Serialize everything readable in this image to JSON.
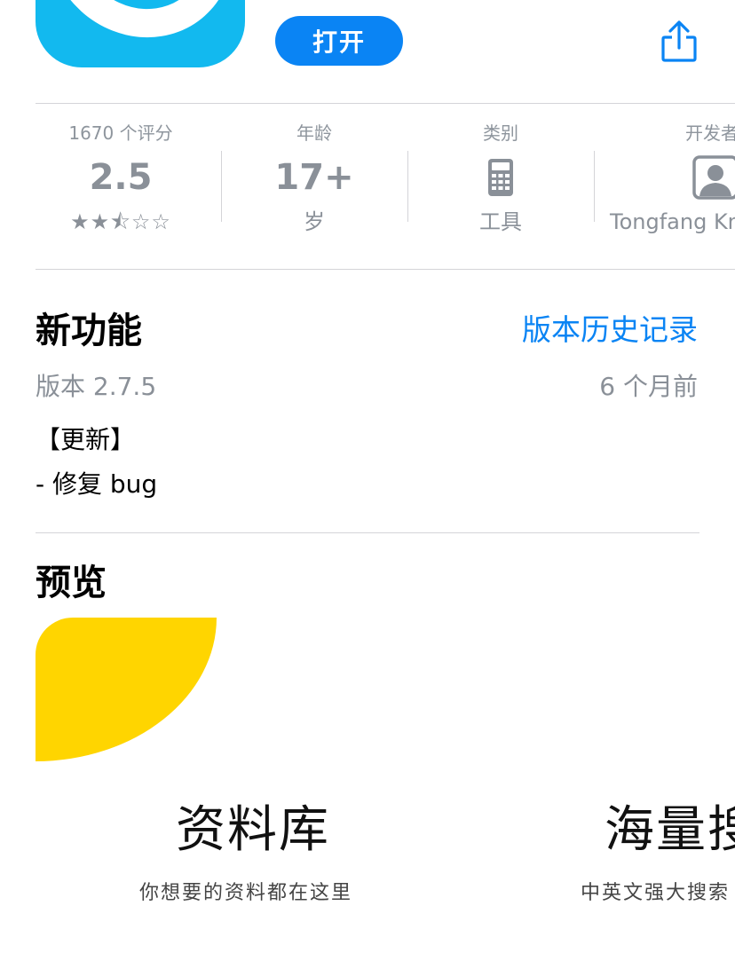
{
  "header": {
    "open_label": "打开"
  },
  "info": {
    "ratings": {
      "head": "1670 个评分",
      "value": "2.5",
      "stars": "★★⯪☆☆"
    },
    "age": {
      "head": "年龄",
      "value": "17+",
      "unit": "岁"
    },
    "category": {
      "head": "类别",
      "value": "工具"
    },
    "developer": {
      "head": "开发者",
      "value": "Tongfang Kn"
    }
  },
  "whats_new": {
    "title": "新功能",
    "history_link": "版本历史记录",
    "version": "版本 2.7.5",
    "time_ago": "6 个月前",
    "notes": [
      "【更新】",
      "- 修复 bug"
    ]
  },
  "preview": {
    "title": "预览",
    "shots": [
      {
        "title": "资料库",
        "subtitle": "你想要的资料都在这里"
      },
      {
        "title": "海量搜",
        "subtitle": "中英文强大搜索"
      }
    ]
  },
  "colors": {
    "accent": "#0a84f4",
    "icon_bg": "#12b9ef",
    "preview_yellow": "#ffd500"
  }
}
